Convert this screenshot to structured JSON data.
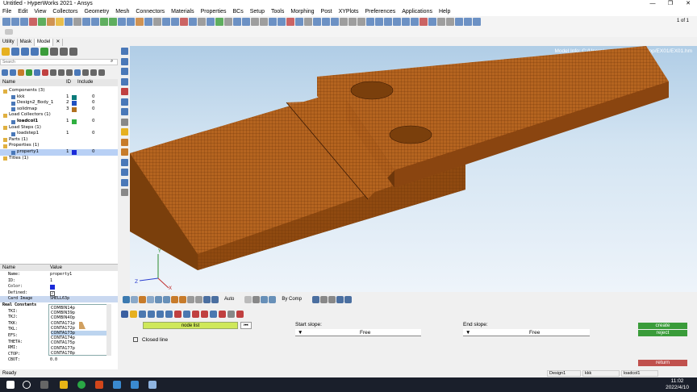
{
  "window": {
    "title": "Untitled - HyperWorks 2021 - Ansys",
    "page_label": "1 of 1"
  },
  "menu": [
    "File",
    "Edit",
    "View",
    "Collectors",
    "Geometry",
    "Mesh",
    "Connectors",
    "Materials",
    "Properties",
    "BCs",
    "Setup",
    "Tools",
    "Morphing",
    "Post",
    "XYPlots",
    "Preferences",
    "Applications",
    "Help"
  ],
  "left_tabs": [
    "Utility",
    "Mask",
    "Model"
  ],
  "search_placeholder": "Search",
  "tree_header": {
    "name": "Name",
    "id": "ID",
    "include": "Include"
  },
  "tree": [
    {
      "label": "Components (3)",
      "indent": 0,
      "id": "",
      "color": "",
      "include": ""
    },
    {
      "label": "kkk",
      "indent": 2,
      "id": "1",
      "color": "#0a7a7a",
      "include": "0"
    },
    {
      "label": "Design2_Body_1",
      "indent": 2,
      "id": "2",
      "color": "#2050c0",
      "include": "0"
    },
    {
      "label": "solidmap",
      "indent": 2,
      "id": "3",
      "color": "#b07020",
      "include": "0"
    },
    {
      "label": "Load Collectors (1)",
      "indent": 0,
      "id": "",
      "color": "",
      "include": ""
    },
    {
      "label": "loadcol1",
      "indent": 2,
      "id": "1",
      "color": "#30b040",
      "include": "0",
      "bold": true
    },
    {
      "label": "Load Steps (1)",
      "indent": 0,
      "id": "",
      "color": "",
      "include": ""
    },
    {
      "label": "loadstep1",
      "indent": 2,
      "id": "1",
      "color": "",
      "include": "0"
    },
    {
      "label": "Parts (1)",
      "indent": 0,
      "id": "",
      "color": "",
      "include": ""
    },
    {
      "label": "Properties (1)",
      "indent": 0,
      "id": "",
      "color": "",
      "include": ""
    },
    {
      "label": "property1",
      "indent": 2,
      "id": "1",
      "color": "#1a2ad8",
      "include": "0",
      "selected": true
    },
    {
      "label": "Titles (1)",
      "indent": 0,
      "id": "",
      "color": "",
      "include": ""
    }
  ],
  "prop_header": {
    "name": "Name",
    "value": "Value"
  },
  "props": [
    {
      "k": "Name:",
      "v": "property1"
    },
    {
      "k": "ID:",
      "v": "1"
    },
    {
      "k": "Color:",
      "v": ""
    },
    {
      "k": "Defined:",
      "v": ""
    },
    {
      "k": "Card Image",
      "v": "SHELL63p",
      "hl": true
    },
    {
      "k": "Real Constants",
      "v": ""
    },
    {
      "k": "TKI:",
      "v": ""
    },
    {
      "k": "TKJ:",
      "v": ""
    },
    {
      "k": "TKK:",
      "v": ""
    },
    {
      "k": "TKL:",
      "v": ""
    },
    {
      "k": "EFS:",
      "v": ""
    },
    {
      "k": "THETA:",
      "v": ""
    },
    {
      "k": "RMI:",
      "v": ""
    },
    {
      "k": "CTOP:",
      "v": "0.0"
    },
    {
      "k": "CBOT:",
      "v": "0.0"
    }
  ],
  "dropdown_items": [
    "COMBIN14p",
    "COMBIN39p",
    "COMBIN40p",
    "CONTA171p",
    "CONTA172p",
    "CONTA173p",
    "CONTA174p",
    "CONTA175p",
    "CONTA177p",
    "CONTA178p"
  ],
  "dropdown_selected": 5,
  "model_info": "Model Info: C:/Users/supergambia/Desktop/EX01/EX01.hm",
  "viewbar": {
    "auto": "Auto",
    "bycomp": "By Comp"
  },
  "panel": {
    "node_list": "node list",
    "start_slope": "Start slope:",
    "end_slope": "End slope:",
    "start_value": "Free",
    "end_value": "Free",
    "closed_line": "Closed line",
    "create": "create",
    "reject": "reject",
    "return": "return"
  },
  "status": {
    "ready": "Ready",
    "comp": "Design1",
    "prop": "kkk",
    "load": "loadcol1"
  },
  "clock": {
    "time": "11:02",
    "date": "2022/4/10"
  }
}
